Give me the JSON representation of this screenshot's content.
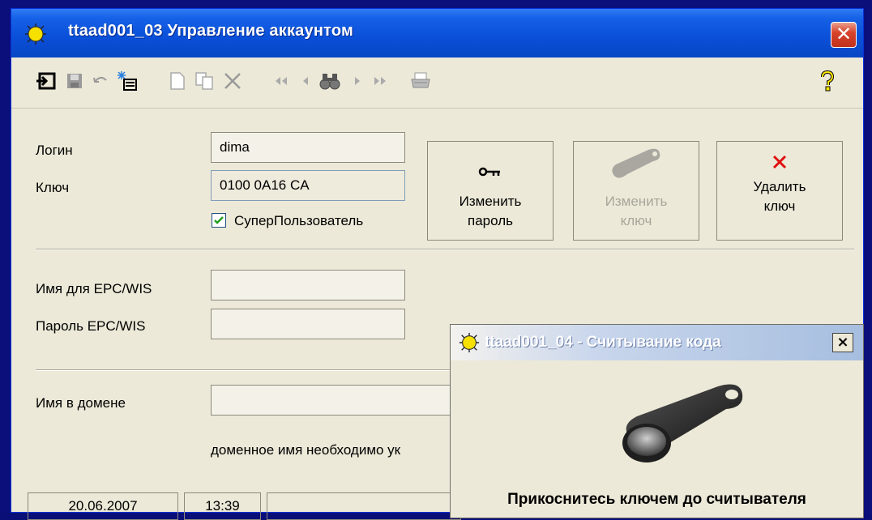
{
  "window": {
    "title": "ttaad001_03  Управление аккаунтом",
    "close": "✕"
  },
  "toolbar": {
    "icons": [
      "exit-icon",
      "save-icon",
      "undo-icon",
      "new-record-icon",
      "new-document-icon",
      "copy-icon",
      "delete-icon",
      "first-icon",
      "previous-icon",
      "find-icon",
      "next-icon",
      "last-icon",
      "print-icon",
      "help-icon"
    ]
  },
  "form": {
    "login_label": "Логин",
    "login_value": "dima",
    "key_label": "Ключ",
    "key_value": "0100 0A16 CA",
    "superuser_label": "СуперПользователь",
    "superuser_checked": true,
    "epc_name_label": "Имя для EPC/WIS",
    "epc_name_value": "",
    "epc_password_label": "Пароль EPC/WIS",
    "epc_password_value": "",
    "domain_label": "Имя в домене",
    "domain_value": "",
    "domain_hint": "доменное имя необходимо ук"
  },
  "buttons": {
    "change_password_line1": "Изменить",
    "change_password_line2": "пароль",
    "change_key_line1": "Изменить",
    "change_key_line2": "ключ",
    "delete_key_line1": "Удалить",
    "delete_key_line2": "ключ"
  },
  "statusbar": {
    "date": "20.06.2007",
    "time": "13:39",
    "extra": ""
  },
  "popup": {
    "title": "ttaad001_04  -  Считывание кода",
    "close": "×",
    "message": "Прикоснитесь ключем до считывателя"
  },
  "colors": {
    "titlebar": "#0a4fd8",
    "window_bg": "#ece9d8",
    "close_red": "#d9442c",
    "frame_blue": "#0b0f7c"
  }
}
